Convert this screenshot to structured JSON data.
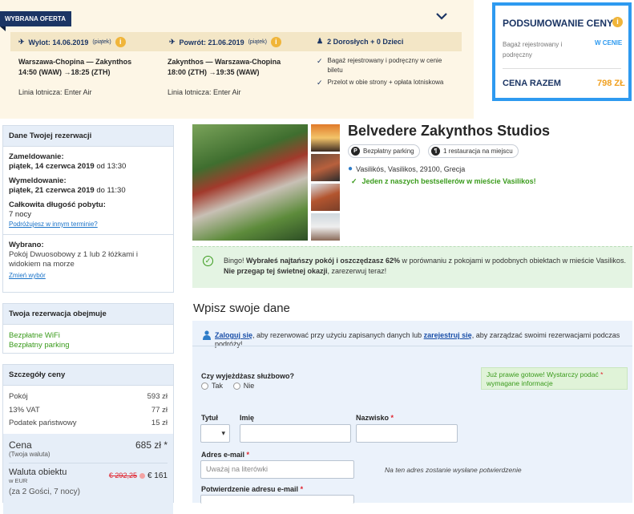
{
  "offer": {
    "tag": "WYBRANA OFERTA",
    "outbound": {
      "label": "Wylot: 14.06.2019",
      "day": "(piątek)",
      "route": "Warszawa-Chopina — Zakynthos",
      "times": "14:50 (WAW) →18:25 (ZTH)",
      "airline": "Linia lotnicza: Enter Air"
    },
    "inbound": {
      "label": "Powrót: 21.06.2019",
      "day": "(piątek)",
      "route": "Zakynthos — Warszawa-Chopina",
      "times": "18:00 (ZTH) →19:35 (WAW)",
      "airline": "Linia lotnicza: Enter Air"
    },
    "travellers": "2 Dorosłych + 0 Dzieci",
    "included": [
      "Bagaż rejestrowany i podręczny w cenie biletu",
      "Przelot w obie strony + opłata lotniskowa"
    ]
  },
  "summary": {
    "title": "PODSUMOWANIE CENY",
    "luggage_label": "Bagaż rejestrowany i podręczny",
    "luggage_value": "W CENIE",
    "total_label": "CENA RAZEM",
    "total_value": "798 ZŁ"
  },
  "booking": {
    "header": "Dane Twojej rezerwacji",
    "checkin_label": "Zameldowanie:",
    "checkin_date": "piątek, 14 czerwca 2019",
    "checkin_time": "od 13:30",
    "checkout_label": "Wymeldowanie:",
    "checkout_date": "piątek, 21 czerwca 2019",
    "checkout_time": "do 11:30",
    "length_label": "Całkowita długość pobytu:",
    "length_value": "7 nocy",
    "other_dates_link": "Podróżujesz w innym terminie?",
    "selected_label": "Wybrano:",
    "selected_value": "Pokój Dwuosobowy z 1 lub 2 łóżkami i widokiem na morze",
    "change_link": "Zmień wybór"
  },
  "includes": {
    "header": "Twoja rezerwacja obejmuje",
    "items": [
      "Bezpłatne WiFi",
      "Bezpłatny parking"
    ]
  },
  "price": {
    "header": "Szczegóły ceny",
    "rows": [
      {
        "label": "Pokój",
        "value": "593 zł"
      },
      {
        "label": "13% VAT",
        "value": "77 zł"
      },
      {
        "label": "Podatek państwowy",
        "value": "15 zł"
      }
    ],
    "total_label": "Cena",
    "total_sub": "(Twoja waluta)",
    "total_value": "685 zł *",
    "eur_label": "Waluta obiektu",
    "eur_sub": "w EUR",
    "eur_old": "€ 292,25",
    "eur_new": "€ 161",
    "guests": "(za 2 Gości, 7 nocy)"
  },
  "hotel": {
    "name": "Belvedere Zakynthos Studios",
    "parking": "Bezpłatny parking",
    "restaurant": "1 restauracja na miejscu",
    "address": "Vasilikós, Vasilikos, 29100, Grecja",
    "bestseller": "Jeden z naszych bestsellerów w mieście Vasilikos!"
  },
  "bingo": {
    "intro": "Bingo!",
    "bold1": "Wybrałeś najtańszy pokój i oszczędzasz 62%",
    "rest1": "w porównaniu z pokojami w podobnych obiektach w mieście Vasilikos.",
    "bold2": "Nie przegap tej świetnej okazji",
    "rest2": ", zarezerwuj teraz!"
  },
  "form": {
    "title": "Wpisz swoje dane",
    "login_link": "Zaloguj się",
    "login_mid": ", aby rezerwować przy użyciu zapisanych danych lub",
    "register_link": "zarejestruj się",
    "login_end": ", aby zarządzać swoimi rezerwacjami podczas podróży!",
    "business_q": "Czy wyjeżdżasz służbowo?",
    "yes": "Tak",
    "no": "Nie",
    "almost_ready": "Już prawie gotowe! Wystarczy podać",
    "almost_ready2": "wymagane informacje",
    "title_label": "Tytuł",
    "first_label": "Imię",
    "last_label": "Nazwisko",
    "email_label": "Adres e-mail",
    "email_placeholder": "Uważaj na literówki",
    "email_note": "Na ten adres zostanie wysłane potwierdzenie",
    "email_confirm_label": "Potwierdzenie adresu e-mail"
  }
}
